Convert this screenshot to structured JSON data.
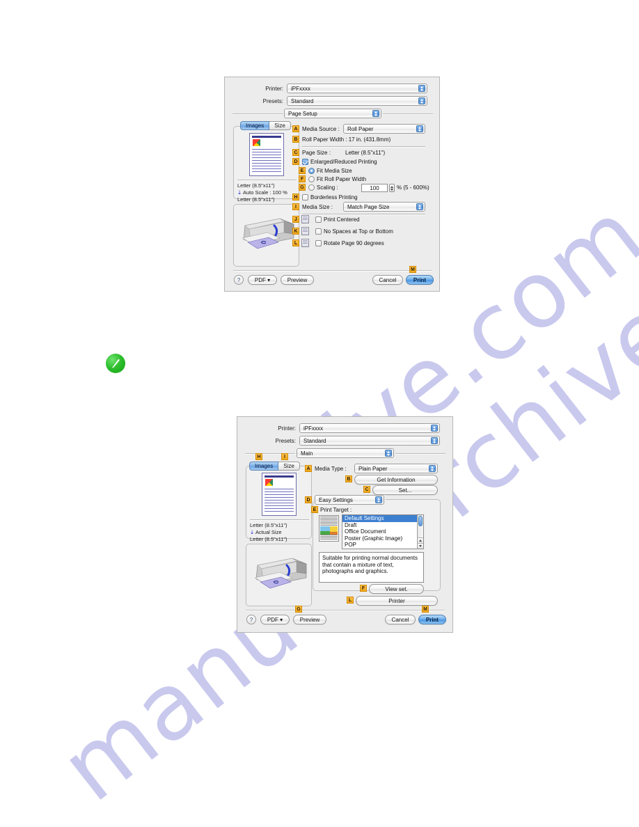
{
  "page": {
    "watermark_line1": "hive.com",
    "watermark_line2": "manualsarchive",
    "note_icon": "green-note-pencil-icon"
  },
  "dialog_page_setup": {
    "printer_label": "Printer:",
    "printer_value": "iPFxxxx",
    "presets_label": "Presets:",
    "presets_value": "Standard",
    "pane_value": "Page Setup",
    "tabs": [
      {
        "label": "Images",
        "selected": true
      },
      {
        "label": "Size",
        "selected": false
      }
    ],
    "preview_info": [
      "Letter (8.5\"x11\")",
      "Auto Scale : 100 %",
      "Letter (8.5\"x11\")"
    ],
    "fields": {
      "media_source_badge": "A",
      "media_source_label": "Media Source :",
      "media_source_value": "Roll Paper",
      "roll_width_badge": "B",
      "roll_width_text": "Roll Paper Width : 17 in. (431.8mm)",
      "page_size_badge": "C",
      "page_size_label": "Page Size :",
      "page_size_value": "Letter (8.5\"x11\")",
      "enlarged_badge": "D",
      "enlarged_label": "Enlarged/Reduced Printing",
      "enlarged_checked": true,
      "fit_media_badge": "E",
      "fit_media_label": "Fit Media Size",
      "fit_media_selected": true,
      "fit_roll_badge": "F",
      "fit_roll_label": "Fit Roll Paper Width",
      "scaling_badge": "G",
      "scaling_label": "Scaling :",
      "scaling_value": "100",
      "scaling_suffix": "% (5 - 600%)",
      "borderless_badge": "H",
      "borderless_label": "Borderless Printing",
      "borderless_checked": false,
      "media_size_badge": "I",
      "media_size_label": "Media Size :",
      "media_size_value": "Match Page Size",
      "print_centered_badge": "J",
      "print_centered_label": "Print Centered",
      "no_spaces_badge": "K",
      "no_spaces_label": "No Spaces at Top or Bottom",
      "rotate_badge": "L",
      "rotate_label": "Rotate Page 90 degrees"
    },
    "buttons": {
      "help": "?",
      "pdf": "PDF ▾",
      "preview": "Preview",
      "cancel": "Cancel",
      "print": "Print",
      "print_badge": "M"
    }
  },
  "dialog_main": {
    "printer_label": "Printer:",
    "printer_value": "iPFxxxx",
    "presets_label": "Presets:",
    "presets_value": "Standard",
    "pane_value": "Main",
    "tabs": [
      {
        "label": "Images",
        "selected": true,
        "badge": "H"
      },
      {
        "label": "Size",
        "selected": false,
        "badge": "I"
      }
    ],
    "preview_info": [
      "Letter (8.5\"x11\")",
      "Actual Size",
      "Letter (8.5\"x11\")"
    ],
    "fields": {
      "media_type_badge": "A",
      "media_type_label": "Media Type :",
      "media_type_value": "Plain Paper",
      "get_information_badge": "B",
      "get_information_label": "Get Information",
      "set_badge": "C",
      "set_label": "Set...",
      "easy_settings_badge": "D",
      "easy_settings_value": "Easy Settings",
      "print_target_badge": "E",
      "print_target_label": "Print Target :",
      "print_target_items": [
        {
          "label": "Default Settings",
          "selected": true
        },
        {
          "label": "Draft",
          "selected": false
        },
        {
          "label": "Office Document",
          "selected": false
        },
        {
          "label": "Poster (Graphic Image)",
          "selected": false
        },
        {
          "label": "POP",
          "selected": false
        }
      ],
      "description": "Suitable for printing normal documents that contain a mixture of text, photographs and graphics.",
      "view_set_badge": "F",
      "view_set_label": "View set.",
      "printer_button_badge": "L",
      "printer_button_label": "Printer"
    },
    "buttons": {
      "help": "?",
      "pdf": "PDF ▾",
      "preview": "Preview",
      "preview_badge": "G",
      "cancel": "Cancel",
      "print": "Print",
      "print_badge": "M"
    }
  }
}
